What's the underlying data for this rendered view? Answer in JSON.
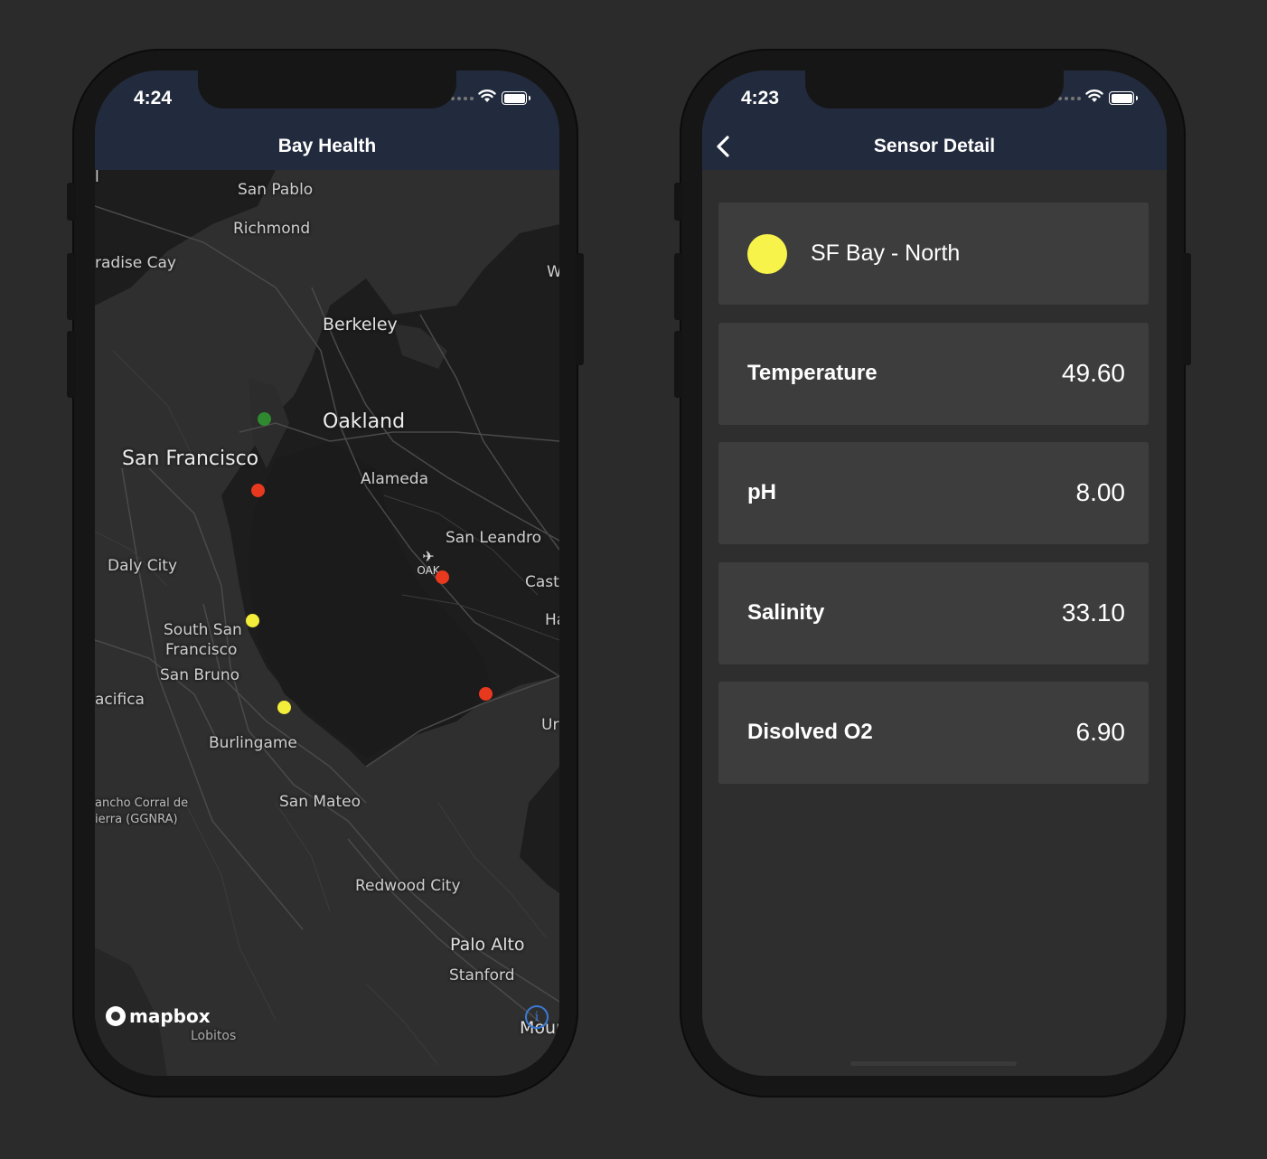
{
  "left_screen": {
    "status_time": "4:24",
    "title": "Bay Health",
    "places": {
      "san_pablo": "San Pablo",
      "richmond": "Richmond",
      "paradise_cay": "radise Cay",
      "w_edge": "W",
      "berkeley": "Berkeley",
      "oakland": "Oakland",
      "san_francisco": "San Francisco",
      "alameda": "Alameda",
      "san_leandro": "San Leandro",
      "castro": "Cast",
      "ha": "Ha",
      "daly_city": "Daly City",
      "south_sf_1": "South San",
      "south_sf_2": "Francisco",
      "san_bruno": "San Bruno",
      "pacifica": "acifica",
      "union": "Ur",
      "burlingame": "Burlingame",
      "san_mateo": "San Mateo",
      "rancho_1": "ancho Corral de",
      "rancho_2": "ierra (GGNRA)",
      "redwood_city": "Redwood City",
      "palo_alto": "Palo Alto",
      "stanford": "Stanford",
      "lobitos": "Lobitos",
      "mountain": "Mour",
      "l_edge": "l"
    },
    "airport_code": "OAK",
    "attribution": "mapbox",
    "info_label": "i",
    "sensor_colors": {
      "green": "#2f8a2f",
      "red": "#e8391f",
      "yellow": "#f3ee3a"
    }
  },
  "right_screen": {
    "status_time": "4:23",
    "title": "Sensor Detail",
    "sensor": {
      "name": "SF Bay - North",
      "status_color": "#f7f34a"
    },
    "readings": [
      {
        "label": "Temperature",
        "value": "49.60"
      },
      {
        "label": "pH",
        "value": "8.00"
      },
      {
        "label": "Salinity",
        "value": "33.10"
      },
      {
        "label": "Disolved O2",
        "value": "6.90"
      }
    ]
  },
  "colors": {
    "nav_bar": "#222b3d",
    "card": "#3d3d3d",
    "background": "#2b2b2b"
  }
}
